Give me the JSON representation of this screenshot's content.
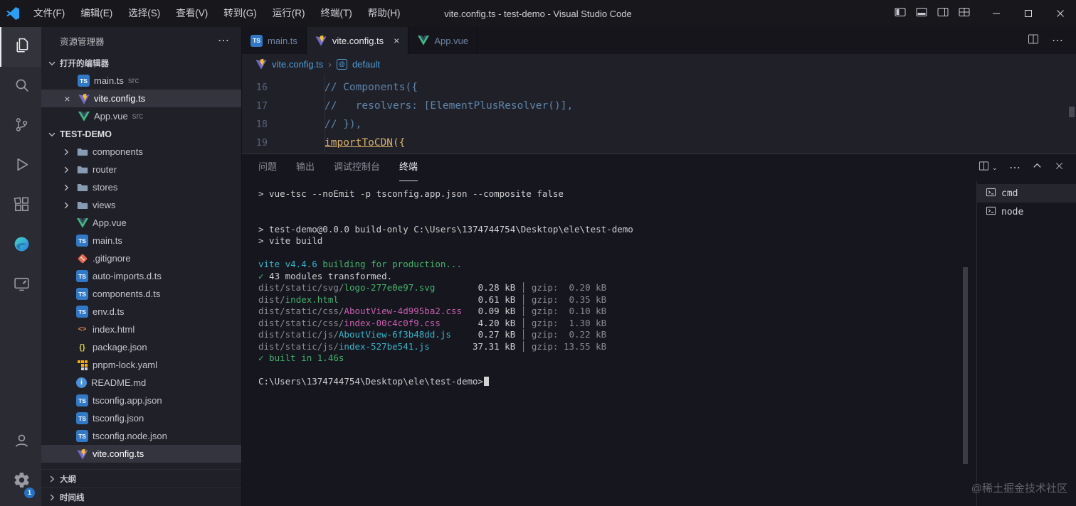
{
  "titlebar": {
    "menus": [
      "文件(F)",
      "编辑(E)",
      "选择(S)",
      "查看(V)",
      "转到(G)",
      "运行(R)",
      "终端(T)",
      "帮助(H)"
    ],
    "title": "vite.config.ts - test-demo - Visual Studio Code"
  },
  "activity_bar": {
    "top": [
      {
        "name": "explorer",
        "active": true
      },
      {
        "name": "search"
      },
      {
        "name": "source-control"
      },
      {
        "name": "run-debug"
      },
      {
        "name": "extensions"
      },
      {
        "name": "edge-tools"
      },
      {
        "name": "devtools"
      }
    ],
    "bottom": [
      {
        "name": "account"
      },
      {
        "name": "settings",
        "badge": "1"
      }
    ]
  },
  "sidebar": {
    "title": "资源管理器",
    "open_editors": {
      "label": "打开的编辑器",
      "items": [
        {
          "file": "main.ts",
          "detail": "src",
          "icon": "ts"
        },
        {
          "file": "vite.config.ts",
          "detail": "",
          "icon": "vite",
          "selected": true,
          "close": true
        },
        {
          "file": "App.vue",
          "detail": "src",
          "icon": "vue"
        }
      ]
    },
    "project": {
      "label": "TEST-DEMO",
      "items": [
        {
          "label": "components",
          "icon": "folder"
        },
        {
          "label": "router",
          "icon": "folder"
        },
        {
          "label": "stores",
          "icon": "folder"
        },
        {
          "label": "views",
          "icon": "folder"
        },
        {
          "label": "App.vue",
          "icon": "vue"
        },
        {
          "label": "main.ts",
          "icon": "ts"
        },
        {
          "label": ".gitignore",
          "icon": "git"
        },
        {
          "label": "auto-imports.d.ts",
          "icon": "ts"
        },
        {
          "label": "components.d.ts",
          "icon": "ts"
        },
        {
          "label": "env.d.ts",
          "icon": "ts"
        },
        {
          "label": "index.html",
          "icon": "html"
        },
        {
          "label": "package.json",
          "icon": "json"
        },
        {
          "label": "pnpm-lock.yaml",
          "icon": "pnpm"
        },
        {
          "label": "README.md",
          "icon": "readme"
        },
        {
          "label": "tsconfig.app.json",
          "icon": "ts"
        },
        {
          "label": "tsconfig.json",
          "icon": "ts"
        },
        {
          "label": "tsconfig.node.json",
          "icon": "ts"
        },
        {
          "label": "vite.config.ts",
          "icon": "vite",
          "selected": true
        }
      ]
    },
    "outline_label": "大纲",
    "timeline_label": "时间线"
  },
  "editor_tabs": [
    {
      "label": "main.ts",
      "icon": "ts"
    },
    {
      "label": "vite.config.ts",
      "icon": "vite",
      "active": true,
      "closable": true
    },
    {
      "label": "App.vue",
      "icon": "vue"
    }
  ],
  "breadcrumb": {
    "file": "vite.config.ts",
    "symbol": "default"
  },
  "editor": {
    "lines": [
      {
        "num": "16",
        "segs": [
          {
            "t": "// Components({",
            "c": "cmt"
          }
        ]
      },
      {
        "num": "17",
        "segs": [
          {
            "t": "//   resolvers: [ElementPlusResolver()],",
            "c": "cmt"
          }
        ]
      },
      {
        "num": "18",
        "segs": [
          {
            "t": "// }),",
            "c": "cmt"
          }
        ]
      },
      {
        "num": "19",
        "segs": [
          {
            "t": "importToCDN",
            "c": "fn"
          },
          {
            "t": "({",
            "c": "fn2"
          }
        ]
      }
    ]
  },
  "panel": {
    "tabs": [
      "问题",
      "输出",
      "调试控制台",
      "终端"
    ],
    "active_tab": "终端",
    "terminals": [
      "cmd",
      "node"
    ]
  },
  "terminal": {
    "lines": [
      {
        "segs": [
          {
            "t": "> vue-tsc --noEmit -p tsconfig.app.json --composite false",
            "c": "fg"
          }
        ]
      },
      {
        "segs": []
      },
      {
        "segs": []
      },
      {
        "segs": [
          {
            "t": "> test-demo@0.0.0 build-only C:\\Users\\1374744754\\Desktop\\ele\\test-demo",
            "c": "fg"
          }
        ]
      },
      {
        "segs": [
          {
            "t": "> vite build",
            "c": "fg"
          }
        ]
      },
      {
        "segs": []
      },
      {
        "segs": [
          {
            "t": "vite v4.4.6 ",
            "c": "cyan"
          },
          {
            "t": "building for production...",
            "c": "green"
          }
        ]
      },
      {
        "segs": [
          {
            "t": "✓",
            "c": "green"
          },
          {
            "t": " 43 modules transformed.",
            "c": "fg"
          }
        ]
      },
      {
        "segs": [
          {
            "t": "dist/static/svg/",
            "c": "dim"
          },
          {
            "t": "logo-277e0e97.svg",
            "c": "green"
          },
          {
            "t": "        0.28 kB",
            "c": "fg"
          },
          {
            "t": " │ gzip:  0.20 kB",
            "c": "dim"
          }
        ]
      },
      {
        "segs": [
          {
            "t": "dist/",
            "c": "dim"
          },
          {
            "t": "index.html",
            "c": "green"
          },
          {
            "t": "                          0.61 kB",
            "c": "fg"
          },
          {
            "t": " │ gzip:  0.35 kB",
            "c": "dim"
          }
        ]
      },
      {
        "segs": [
          {
            "t": "dist/static/css/",
            "c": "dim"
          },
          {
            "t": "AboutView-4d995ba2.css",
            "c": "magenta"
          },
          {
            "t": "   0.09 kB",
            "c": "fg"
          },
          {
            "t": " │ gzip:  0.10 kB",
            "c": "dim"
          }
        ]
      },
      {
        "segs": [
          {
            "t": "dist/static/css/",
            "c": "dim"
          },
          {
            "t": "index-00c4c0f9.css",
            "c": "magenta"
          },
          {
            "t": "       4.20 kB",
            "c": "fg"
          },
          {
            "t": " │ gzip:  1.30 kB",
            "c": "dim"
          }
        ]
      },
      {
        "segs": [
          {
            "t": "dist/static/js/",
            "c": "dim"
          },
          {
            "t": "AboutView-6f3b48dd.js",
            "c": "cyan"
          },
          {
            "t": "     0.27 kB",
            "c": "fg"
          },
          {
            "t": " │ gzip:  0.22 kB",
            "c": "dim"
          }
        ]
      },
      {
        "segs": [
          {
            "t": "dist/static/js/",
            "c": "dim"
          },
          {
            "t": "index-527be541.js",
            "c": "cyan"
          },
          {
            "t": "        37.31 kB",
            "c": "fg"
          },
          {
            "t": " │ gzip: 13.55 kB",
            "c": "dim"
          }
        ]
      },
      {
        "segs": [
          {
            "t": "✓ built in 1.46s",
            "c": "green"
          }
        ]
      },
      {
        "segs": []
      },
      {
        "segs": [
          {
            "t": "C:\\Users\\1374744754\\Desktop\\ele\\test-demo>",
            "c": "fg"
          }
        ],
        "cursor": true
      }
    ]
  },
  "watermark": "@稀土掘金技术社区"
}
